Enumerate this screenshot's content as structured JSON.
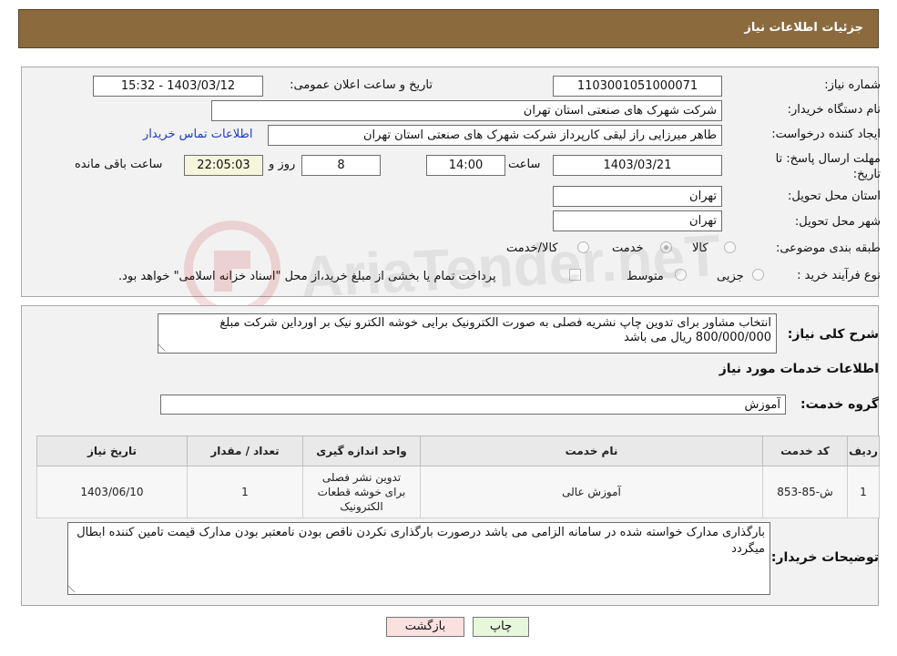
{
  "header": {
    "title": "جزئیات اطلاعات نیاز"
  },
  "need_number": {
    "label": "شماره نیاز:",
    "value": "1103001051000071"
  },
  "announce": {
    "label": "تاریخ و ساعت اعلان عمومی:",
    "value": "1403/03/12 - 15:32"
  },
  "buyer_org": {
    "label": "نام دستگاه خریدار:",
    "value": "شرکت شهرک های صنعتی استان تهران"
  },
  "requester": {
    "label": "ایجاد کننده درخواست:",
    "value": "طاهر  میرزایی راز لیقی کارپرداز شرکت شهرک های صنعتی استان تهران",
    "contact_link": "اطلاعات تماس خریدار"
  },
  "deadline": {
    "label": "مهلت ارسال پاسخ: تا تاریخ:",
    "date": "1403/03/21",
    "time_label": "ساعت",
    "time": "14:00",
    "days": "8",
    "days_label": "روز و",
    "remaining": "22:05:03",
    "remaining_label": "ساعت باقی مانده"
  },
  "delivery_province": {
    "label": "استان محل تحویل:",
    "value": "تهران"
  },
  "delivery_city": {
    "label": "شهر محل تحویل:",
    "value": "تهران"
  },
  "category": {
    "label": "طبقه بندی موضوعی:",
    "options": [
      "کالا",
      "خدمت",
      "کالا/خدمت"
    ],
    "selected": "خدمت"
  },
  "purchase_process": {
    "label": "نوع فرآیند خرید :",
    "options": [
      "جزیی",
      "متوسط"
    ],
    "note": "پرداخت تمام یا بخشی از مبلغ خرید،از محل \"اسناد خزانه اسلامی\" خواهد بود."
  },
  "general_description": {
    "label": "شرح کلی نیاز:",
    "value": "انتخاب مشاور برای تدوین چاپ نشریه فصلی به صورت الکترونیک برایی خوشه الکترو نیک بر اورداین شرکت مبلغ 800/000/000 ریال می باشد"
  },
  "services_section": {
    "title": "اطلاعات خدمات مورد نیاز"
  },
  "service_group": {
    "label": "گروه خدمت:",
    "value": "آموزش"
  },
  "table": {
    "headers": [
      "ردیف",
      "کد خدمت",
      "نام خدمت",
      "واحد اندازه گیری",
      "تعداد / مقدار",
      "تاریخ نیاز"
    ],
    "rows": [
      [
        "1",
        "ش-85-853",
        "آموزش عالی",
        "تدوین نشر فصلی برای خوشه قطعات الکترونیک",
        "1",
        "1403/06/10"
      ]
    ]
  },
  "buyer_notes": {
    "label": "توضیحات خریدار:",
    "value": "بارگذاری مدارک خواسته شده در سامانه الزامی  می باشد درصورت بارگذاری نکردن ناقص بودن نامعتبر بودن مدارک قیمت تامین کننده ابطال میگردد"
  },
  "buttons": {
    "print": "چاپ",
    "back": "بازگشت"
  },
  "watermark": {
    "text": "AriaTender.neT"
  },
  "colors": {
    "header": "#8b6a3e",
    "panel": "#f2f2f2",
    "link": "#1a3cc8",
    "print_btn": "#e6f7dc",
    "back_btn": "#fbe0e0"
  }
}
